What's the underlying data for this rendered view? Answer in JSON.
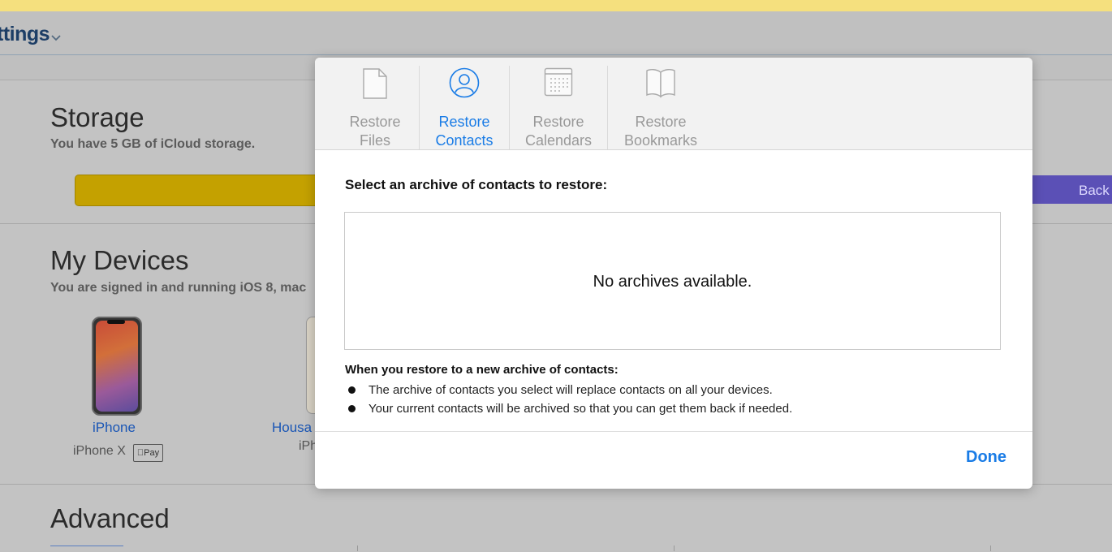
{
  "header": {
    "app_title": "ttings"
  },
  "storage": {
    "title": "Storage",
    "subtitle": "You have 5 GB of iCloud storage.",
    "backup_label": "Back"
  },
  "devices": {
    "title": "My Devices",
    "subtitle": "You are signed in and running iOS 8, mac",
    "items": [
      {
        "name": "iPhone",
        "model": "iPhone X",
        "badge": "Pay"
      },
      {
        "name": "Housa",
        "model": "iPh"
      }
    ]
  },
  "advanced": {
    "title": "Advanced"
  },
  "modal": {
    "tabs": [
      {
        "line1": "Restore",
        "line2": "Files",
        "icon": "file-icon"
      },
      {
        "line1": "Restore",
        "line2": "Contacts",
        "icon": "contact-icon",
        "active": true
      },
      {
        "line1": "Restore",
        "line2": "Calendars",
        "icon": "calendar-icon"
      },
      {
        "line1": "Restore",
        "line2": "Bookmarks",
        "icon": "book-icon"
      }
    ],
    "prompt": "Select an archive of contacts to restore:",
    "empty_message": "No archives available.",
    "info_heading": "When you restore to a new archive of contacts:",
    "info_items": [
      "The archive of contacts you select will replace contacts on all your devices.",
      "Your current contacts will be archived so that you can get them back if needed."
    ],
    "done_label": "Done"
  },
  "colors": {
    "accent": "#1a7ce6",
    "storage_fill": "#c4a100",
    "backup_fill": "#5b50b6",
    "top_strip": "#f5e07e"
  }
}
